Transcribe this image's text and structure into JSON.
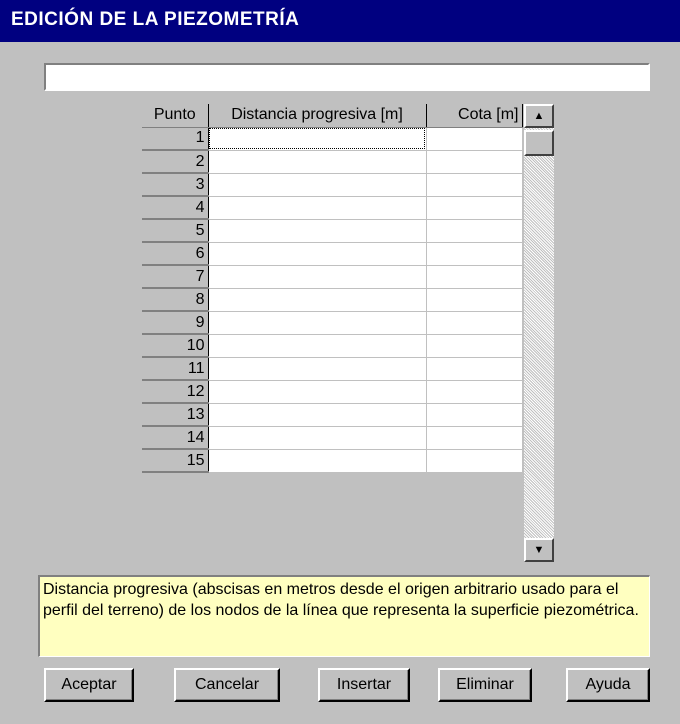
{
  "window": {
    "title": "EDICIÓN DE LA PIEZOMETRÍA"
  },
  "name_field": {
    "value": ""
  },
  "grid": {
    "headers": [
      "Punto",
      "Distancia progresiva [m]",
      "Cota [m]"
    ],
    "rows": [
      {
        "punto": "1",
        "distancia": "",
        "cota": ""
      },
      {
        "punto": "2",
        "distancia": "",
        "cota": ""
      },
      {
        "punto": "3",
        "distancia": "",
        "cota": ""
      },
      {
        "punto": "4",
        "distancia": "",
        "cota": ""
      },
      {
        "punto": "5",
        "distancia": "",
        "cota": ""
      },
      {
        "punto": "6",
        "distancia": "",
        "cota": ""
      },
      {
        "punto": "7",
        "distancia": "",
        "cota": ""
      },
      {
        "punto": "8",
        "distancia": "",
        "cota": ""
      },
      {
        "punto": "9",
        "distancia": "",
        "cota": ""
      },
      {
        "punto": "10",
        "distancia": "",
        "cota": ""
      },
      {
        "punto": "11",
        "distancia": "",
        "cota": ""
      },
      {
        "punto": "12",
        "distancia": "",
        "cota": ""
      },
      {
        "punto": "13",
        "distancia": "",
        "cota": ""
      },
      {
        "punto": "14",
        "distancia": "",
        "cota": ""
      },
      {
        "punto": "15",
        "distancia": "",
        "cota": ""
      }
    ]
  },
  "help_text": "Distancia progresiva (abscisas en metros desde el origen arbitrario usado para el perfil del terreno) de los nodos de la línea que representa la superficie piezométrica.",
  "buttons": {
    "accept": "Aceptar",
    "cancel": "Cancelar",
    "insert": "Insertar",
    "delete": "Eliminar",
    "help": "Ayuda"
  }
}
